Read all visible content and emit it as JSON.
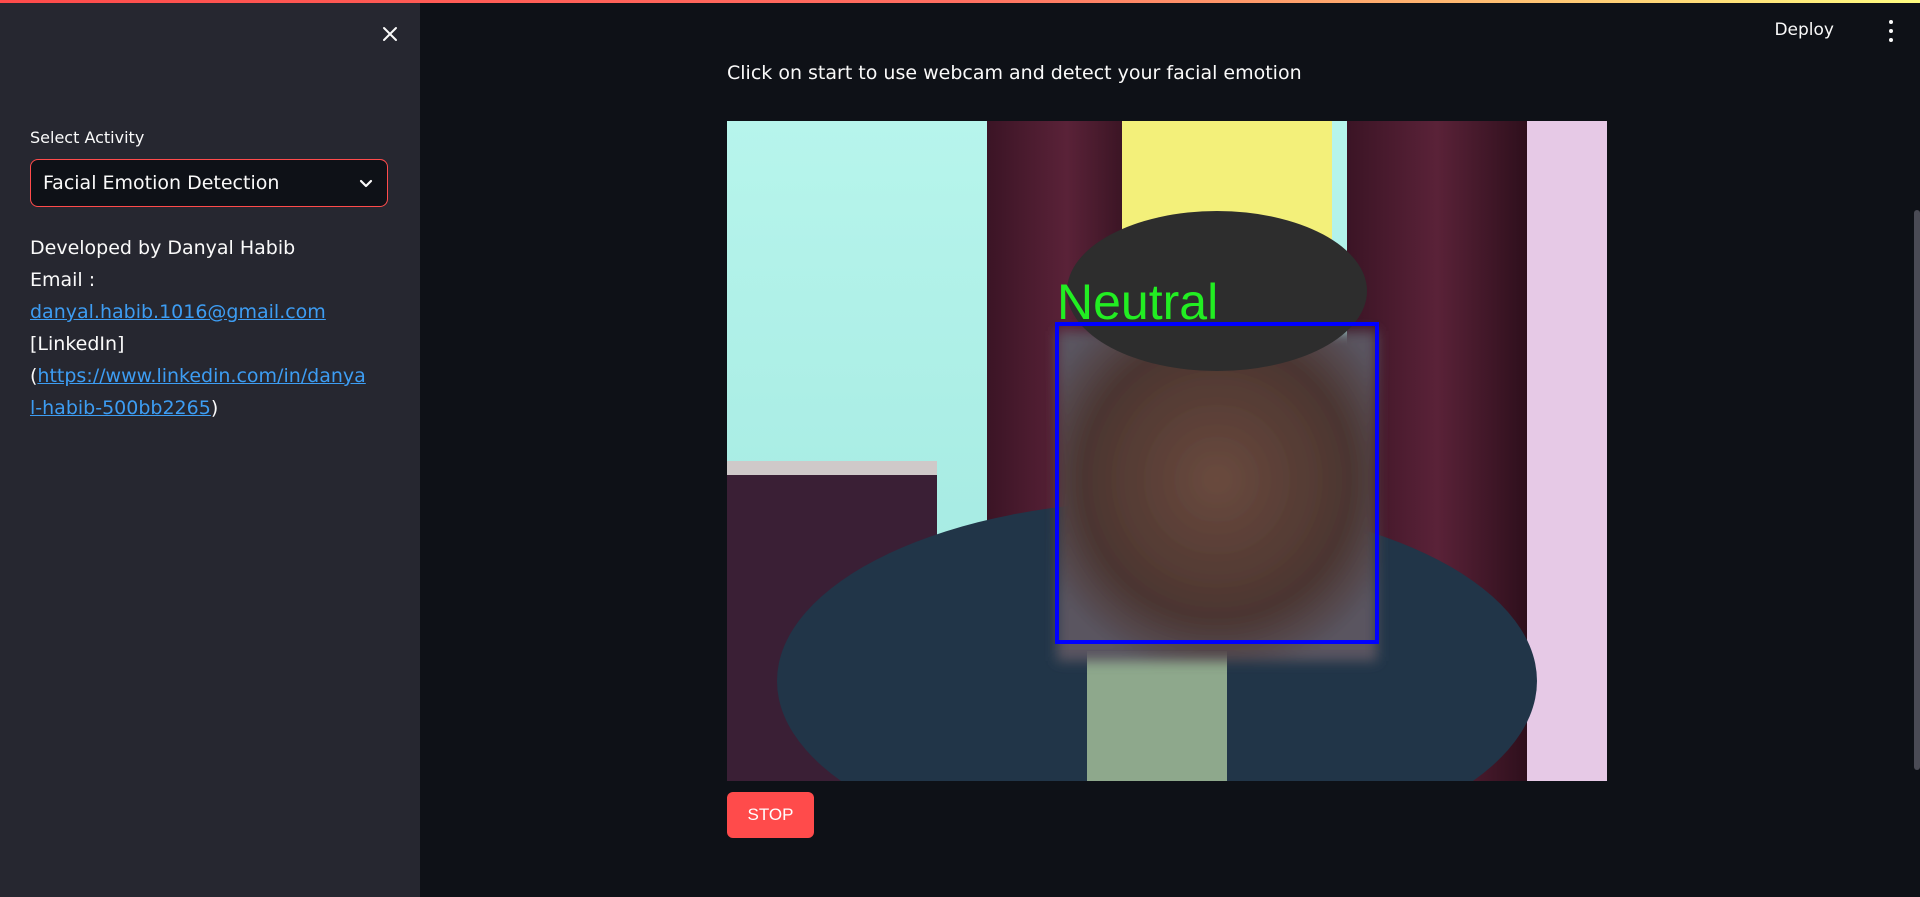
{
  "sidebar": {
    "select_label": "Select Activity",
    "select_value": "Facial Emotion Detection",
    "developer_line": "Developed by Danyal Habib",
    "email_prefix": "Email : ",
    "email": "danyal.habib.1016@gmail.com",
    "linkedin_label": "[LinkedIn]",
    "linkedin_open": "(",
    "linkedin_url": "https://www.linkedin.com/in/danyal-habib-500bb2265",
    "linkedin_close": ")"
  },
  "header": {
    "deploy_label": "Deploy"
  },
  "main": {
    "instruction": "Click on start to use webcam and detect your facial emotion",
    "detected_emotion": "Neutral",
    "stop_label": "STOP"
  },
  "colors": {
    "accent": "#ff4b4b",
    "link": "#3d9df3",
    "emotion_text": "#22ee22",
    "face_box": "#0000ff"
  },
  "icons": {
    "close": "close-icon",
    "chevron": "chevron-down-icon",
    "menu": "kebab-menu-icon"
  }
}
